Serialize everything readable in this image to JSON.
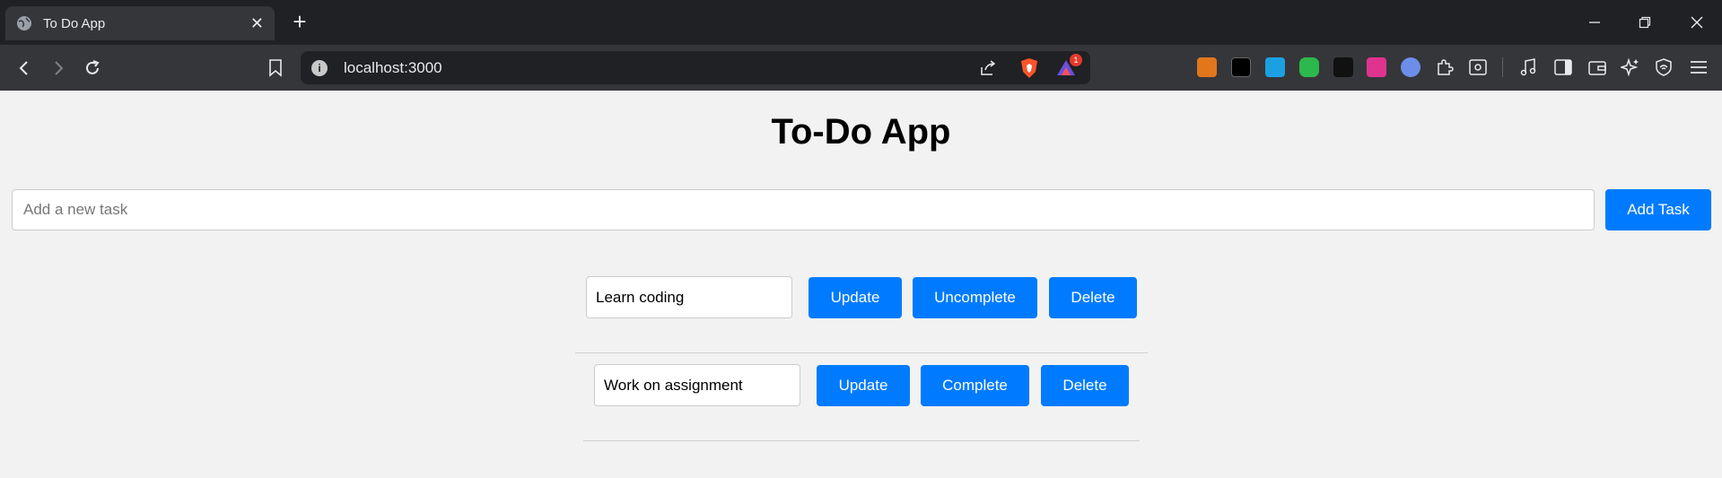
{
  "browser": {
    "tab_title": "To Do App",
    "url": "localhost:3000",
    "notification_count": "1",
    "accent_colors": {
      "tabstrip": "#202124",
      "toolbar": "#35363a",
      "omnibox": "#202124"
    }
  },
  "app": {
    "title": "To-Do App",
    "new_task_placeholder": "Add a new task",
    "add_button": "Add Task",
    "button_color": "#007bff"
  },
  "tasks": [
    {
      "text": "Learn coding",
      "update_label": "Update",
      "toggle_label": "Uncomplete",
      "delete_label": "Delete"
    },
    {
      "text": "Work on assignment",
      "update_label": "Update",
      "toggle_label": "Complete",
      "delete_label": "Delete"
    }
  ]
}
